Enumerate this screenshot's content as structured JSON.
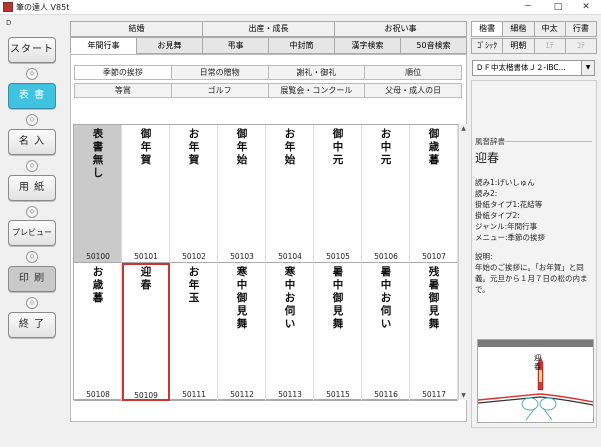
{
  "title": "筆の達人 V85t",
  "window_controls": {
    "minimize": "－",
    "maximize": "□",
    "close": "✕"
  },
  "left_marker": "D",
  "nav": [
    {
      "label": "スタート"
    },
    {
      "label": "表 書"
    },
    {
      "label": "名 入"
    },
    {
      "label": "用 紙"
    },
    {
      "label": "プレビュー"
    },
    {
      "label": "印 刷"
    },
    {
      "label": "終 了"
    }
  ],
  "nav_arrow": "◇",
  "categories": [
    "結婚",
    "出産・成長",
    "お祝い事"
  ],
  "tabs": [
    "年間行事",
    "お見舞",
    "弔事",
    "中封筒",
    "漢字検索",
    "50音検索"
  ],
  "chips_row1": [
    "季節の挨拶",
    "日常の贈物",
    "謝礼・御礼",
    "順位"
  ],
  "chips_row2": [
    "等賞",
    "ゴルフ",
    "展覧会・コンクール",
    "父母・成人の日"
  ],
  "cards_row1": [
    {
      "text": "表\n書\n無\nし",
      "code": "50100"
    },
    {
      "text": "御\n年\n賀",
      "code": "50101"
    },
    {
      "text": "お\n年\n賀",
      "code": "50102"
    },
    {
      "text": "御\n年\n始",
      "code": "50103"
    },
    {
      "text": "お\n年\n始",
      "code": "50104"
    },
    {
      "text": "御\n中\n元",
      "code": "50105"
    },
    {
      "text": "お\n中\n元",
      "code": "50106"
    },
    {
      "text": "御\n歳\n暮",
      "code": "50107"
    }
  ],
  "cards_row2": [
    {
      "text": "お\n歳\n暮",
      "code": "50108"
    },
    {
      "text": "迎\n春",
      "code": "50109"
    },
    {
      "text": "お\n年\n玉",
      "code": "50111"
    },
    {
      "text": "寒\n中\n御\n見\n舞",
      "code": "50112"
    },
    {
      "text": "寒\n中\nお\n伺\nい",
      "code": "50113"
    },
    {
      "text": "暑\n中\n御\n見\n舞",
      "code": "50115"
    },
    {
      "text": "暑\n中\nお\n伺\nい",
      "code": "50116"
    },
    {
      "text": "残\n暑\n御\n見\n舞",
      "code": "50117"
    }
  ],
  "right_tabs1": [
    "楷書",
    "細楷",
    "中太",
    "行書"
  ],
  "right_tabs2": [
    "ｺﾞｼｯｸ",
    "明朝",
    "ｴﾃ",
    "ｺﾃ"
  ],
  "font_select": "ＤＦ中太楷書体Ｊ２-IBC...",
  "dict_label": "風習辞書",
  "dict_word": "迎春",
  "dict_info": [
    "読み1:げいしゅん",
    "読み2:",
    "掛紙タイプ1:花結等",
    "掛紙タイプ2:",
    "ジャンル:年間行事",
    "メニュー:季節の挨拶"
  ],
  "explanation_title": "説明:",
  "explanation": "年始のご挨拶に。「お年賀」と同義。元旦から１月７日の松の内まで。",
  "preview_text": "迎\n春"
}
